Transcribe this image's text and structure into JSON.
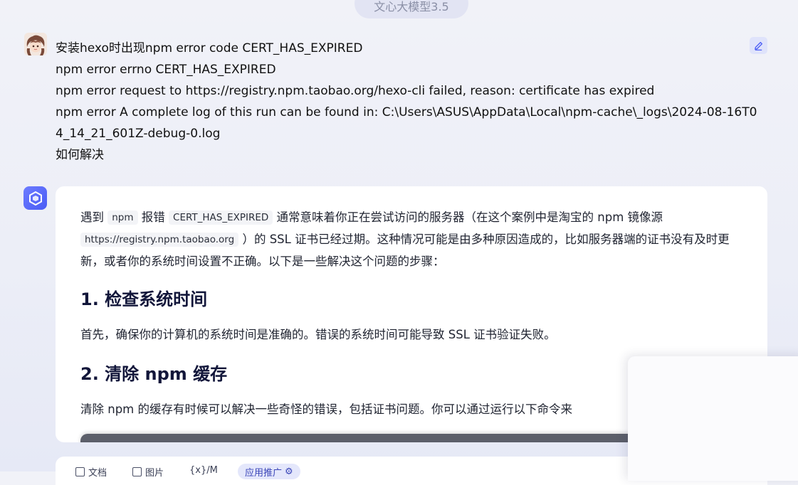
{
  "header": {
    "model_label": "文心大模型3.5"
  },
  "user_message": {
    "lines": [
      "安装hexo时出现npm error code CERT_HAS_EXPIRED",
      "npm error errno CERT_HAS_EXPIRED",
      "npm error request to https://registry.npm.taobao.org/hexo-cli failed, reason: certificate has expired",
      "npm error A complete log of this run can be found in: C:\\Users\\ASUS\\AppData\\Local\\npm-cache\\_logs\\2024-08-16T0",
      "4_14_21_601Z-debug-0.log",
      "如何解决"
    ]
  },
  "answer": {
    "p1": {
      "t1": "遇到",
      "code1": "npm",
      "t2": "报错",
      "code2": "CERT_HAS_EXPIRED",
      "t3": "通常意味着你正在尝试访问的服务器（在这个案例中是淘宝的 npm 镜像源",
      "code3": "https://registry.npm.taobao.org",
      "t4": "）的 SSL 证书已经过期。这种情况可能是由多种原因造成的，比如服务器端的证书没有及时更新，或者你的系统时间设置不正确。以下是一些解决这个问题的步骤："
    },
    "section1": {
      "heading": "1. 检查系统时间",
      "text": "首先，确保你的计算机的系统时间是准确的。错误的系统时间可能导致 SSL 证书验证失败。"
    },
    "section2": {
      "heading": "2. 清除 npm 缓存",
      "text": "清除 npm 的缓存有时候可以解决一些奇怪的错误，包括证书问题。你可以通过运行以下命令来"
    }
  },
  "toolbar": {
    "item1": "文档",
    "item2": "图片",
    "item3": "{x}/M",
    "pill": "应用推广"
  },
  "colors": {
    "accent": "#4a5cf5",
    "heading": "#12163a",
    "code_bg": "#f3f4f7"
  }
}
